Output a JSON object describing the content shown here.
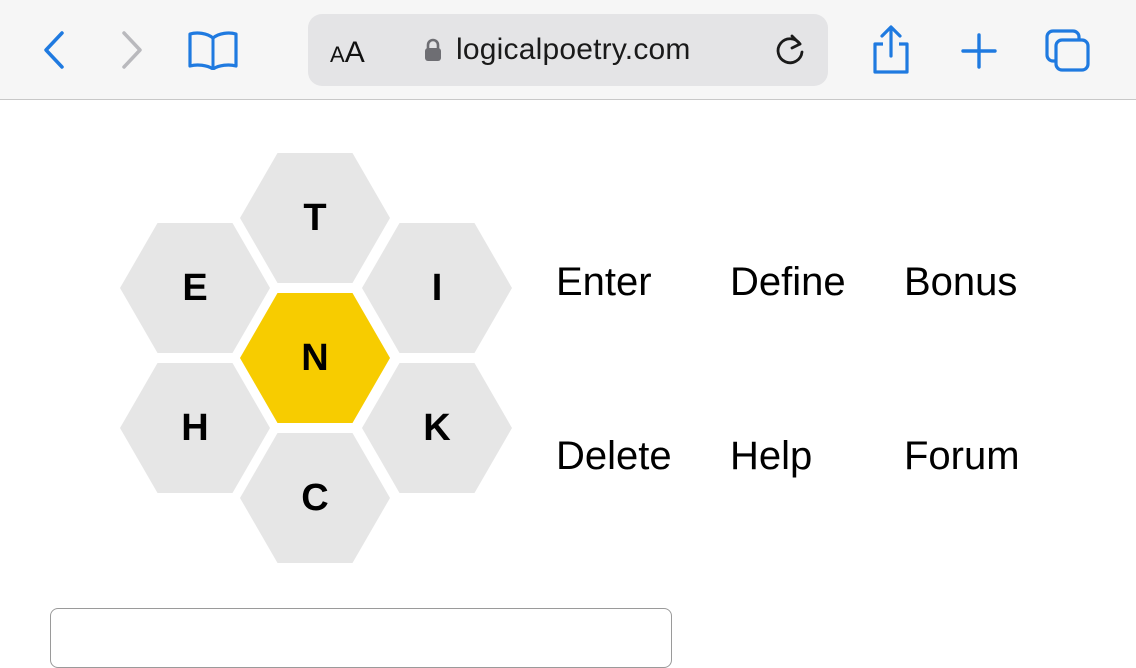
{
  "browser": {
    "url": "logicalpoetry.com",
    "text_size_small": "A",
    "text_size_large": "A",
    "accent_color": "#1f7ae0"
  },
  "icons": {
    "back": "chevron-left-icon",
    "forward": "chevron-right-icon",
    "reader": "book-icon",
    "lock": "lock-icon",
    "reload": "reload-icon",
    "share": "share-icon",
    "new_tab": "plus-icon",
    "tabs": "tabs-icon"
  },
  "puzzle": {
    "center_letter": "N",
    "outer_letters": {
      "top": "T",
      "upper_left": "E",
      "upper_right": "I",
      "lower_left": "H",
      "lower_right": "K",
      "bottom": "C"
    },
    "center_color": "#f7cc00",
    "outer_color": "#e6e6e6"
  },
  "actions": {
    "enter": "Enter",
    "define": "Define",
    "bonus": "Bonus",
    "delete": "Delete",
    "help": "Help",
    "forum": "Forum"
  },
  "word_input": {
    "value": ""
  }
}
